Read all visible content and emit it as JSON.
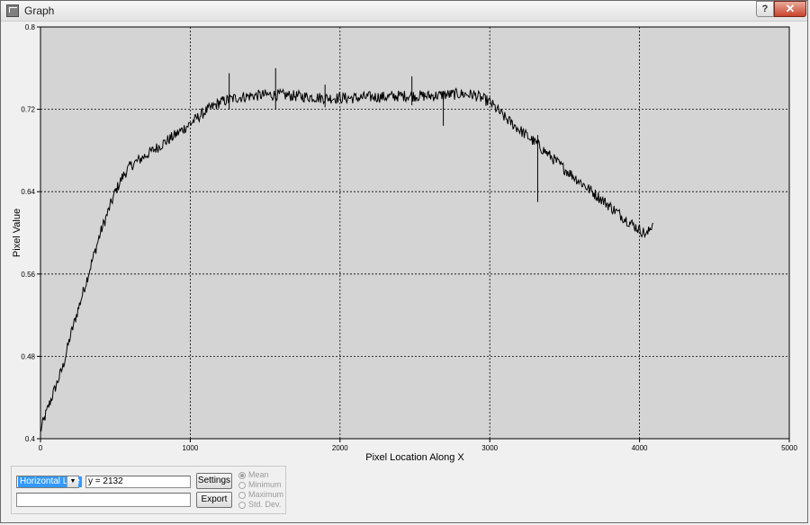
{
  "window": {
    "title": "Graph",
    "help_label": "?",
    "close_label": "✕",
    "icon": "graph-window-icon"
  },
  "chart_data": {
    "type": "line",
    "xlabel": "Pixel Location Along X",
    "ylabel": "Pixel Value",
    "xlim": [
      0,
      5000
    ],
    "ylim": [
      0.4,
      0.8
    ],
    "x_ticks": [
      "0",
      "1000",
      "2000",
      "3000",
      "4000",
      "5000"
    ],
    "y_ticks": [
      "0.4",
      "0.48",
      "0.56",
      "0.64",
      "0.72",
      "0.8"
    ],
    "grid": true,
    "plot_background": "#d4d4d4",
    "line_color": "#000000",
    "series": [
      {
        "x": [
          0,
          50,
          100,
          150,
          200,
          250,
          300,
          350,
          400,
          450,
          500,
          550,
          600,
          700,
          800,
          900,
          1000,
          1100,
          1200,
          1300,
          1400,
          1500,
          1600,
          1700,
          1800,
          1900,
          2000,
          2100,
          2200,
          2300,
          2400,
          2500,
          2600,
          2700,
          2800,
          2900,
          3000,
          3100,
          3200,
          3300,
          3400,
          3500,
          3600,
          3700,
          3800,
          3900,
          4000,
          4050,
          4090
        ],
        "values": [
          0.408,
          0.43,
          0.45,
          0.47,
          0.5,
          0.525,
          0.55,
          0.575,
          0.6,
          0.62,
          0.64,
          0.655,
          0.665,
          0.675,
          0.685,
          0.695,
          0.706,
          0.718,
          0.727,
          0.731,
          0.733,
          0.734,
          0.734,
          0.733,
          0.732,
          0.731,
          0.731,
          0.731,
          0.732,
          0.732,
          0.733,
          0.733,
          0.733,
          0.734,
          0.735,
          0.734,
          0.727,
          0.712,
          0.7,
          0.688,
          0.675,
          0.662,
          0.65,
          0.638,
          0.626,
          0.614,
          0.603,
          0.598,
          0.61
        ]
      }
    ],
    "spikes": [
      {
        "x": 1260,
        "top": 0.755,
        "bottom": 0.72
      },
      {
        "x": 1570,
        "top": 0.76,
        "bottom": 0.72
      },
      {
        "x": 1900,
        "top": 0.744,
        "bottom": 0.722
      },
      {
        "x": 2480,
        "top": 0.752,
        "bottom": 0.724
      },
      {
        "x": 2690,
        "top": 0.738,
        "bottom": 0.704
      },
      {
        "x": 3320,
        "top": 0.695,
        "bottom": 0.63
      }
    ]
  },
  "controls": {
    "mode_select_value": "Horizontal Line",
    "position_value": "y = 2132",
    "second_field_value": "",
    "settings_label": "Settings",
    "export_label": "Export",
    "radio_options": [
      {
        "label": "Mean",
        "checked": true
      },
      {
        "label": "Minimum",
        "checked": false
      },
      {
        "label": "Maximum",
        "checked": false
      },
      {
        "label": "Std. Dev.",
        "checked": false
      }
    ]
  }
}
